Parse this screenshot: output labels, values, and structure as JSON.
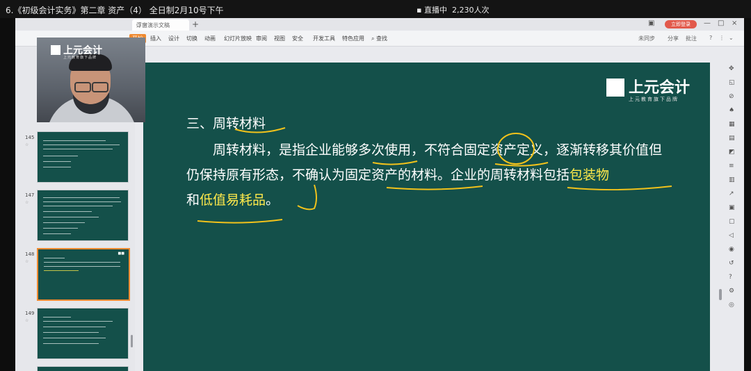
{
  "topbar": {
    "title": "6.《初级会计实务》第二章 资产（4） 全日制2月10号下午",
    "live_status": "直播中",
    "viewer_count": "2,230人次"
  },
  "webcam": {
    "logo_text": "上元会计",
    "logo_sub": "上元教育旗下品牌"
  },
  "wps": {
    "doc_tab": "浮窗演示文稿",
    "login_button": "立即登录",
    "ribbon_tabs": [
      "开始",
      "插入",
      "设计",
      "切换",
      "动画",
      "幻灯片放映",
      "审阅",
      "视图",
      "安全",
      "开发工具",
      "特色应用"
    ],
    "search_label": "查找",
    "right_tools": [
      "未同步",
      "分享",
      "批注"
    ],
    "help": "?"
  },
  "thumbnails": [
    {
      "num": "145",
      "sub": "☆"
    },
    {
      "num": "147",
      "sub": "☆"
    },
    {
      "num": "148",
      "sub": "☆"
    },
    {
      "num": "149",
      "sub": "☆"
    }
  ],
  "slide": {
    "logo_text": "上元会计",
    "logo_sub": "上元教育旗下品牌",
    "heading": "三、周转材料",
    "para_part1": "周转材料，是指企业能够多次使用，不符合固定资产定义，逐渐转移其价值但仍保持原有形态，不确认为固定资产的材料。企业的周转材料包括",
    "hl1": "包装物",
    "mid": "和",
    "hl2": "低值易耗品",
    "end": "。"
  },
  "colors": {
    "slide_bg": "#14504a",
    "highlight": "#ffe94a",
    "ink": "#f2c21b",
    "accent": "#f08a30"
  }
}
